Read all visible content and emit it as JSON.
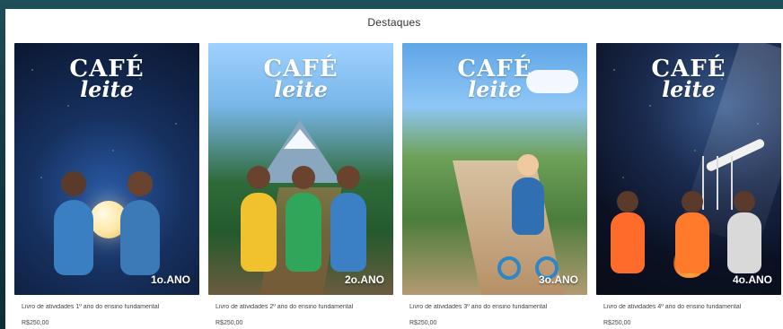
{
  "section": {
    "title": "Destaques"
  },
  "products": [
    {
      "logo_line1": "CAFÉ",
      "logo_line2": "leite",
      "badge": "1o.ANO",
      "description": "Livro de atividades 1º ano do ensino fundamental",
      "price": "R$250,00"
    },
    {
      "logo_line1": "CAFÉ",
      "logo_line2": "leite",
      "badge": "2o.ANO",
      "description": "Livro de atividades 2º ano do ensino fundamental",
      "price": "R$250,00"
    },
    {
      "logo_line1": "CAFÉ",
      "logo_line2": "leite",
      "badge": "3o.ANO",
      "description": "Livro de atividades 3º ano do ensino fundamental",
      "price": "R$250,00"
    },
    {
      "logo_line1": "CAFÉ",
      "logo_line2": "leite",
      "badge": "4o.ANO",
      "description": "Livro de atividades 4º ano do ensino fundamental",
      "price": "R$250,00"
    }
  ]
}
